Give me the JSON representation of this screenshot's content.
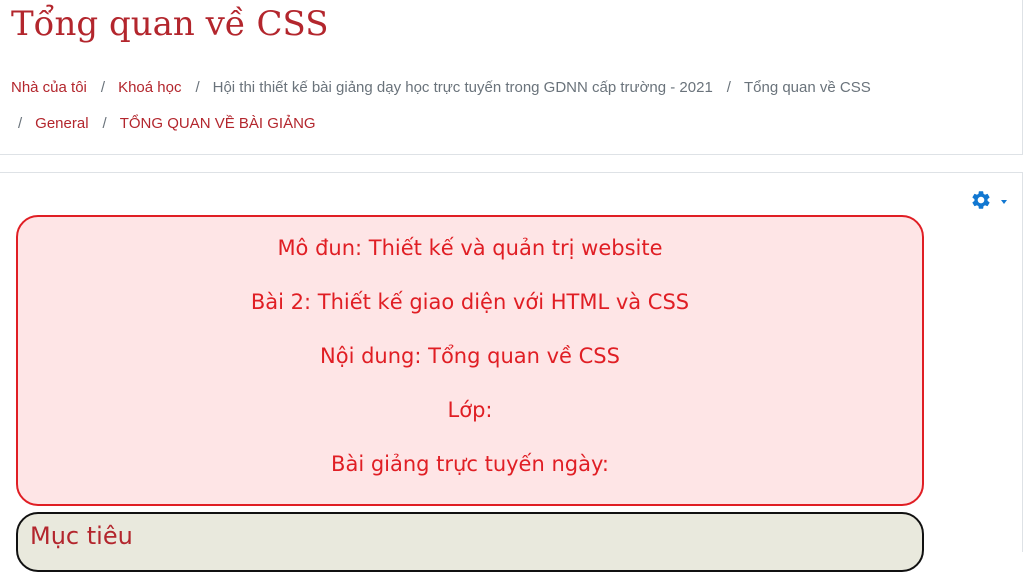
{
  "page": {
    "title": "Tổng quan về CSS"
  },
  "breadcrumb": {
    "items": [
      {
        "label": "Nhà của tôi",
        "link": true
      },
      {
        "label": "Khoá học",
        "link": true
      },
      {
        "label": "Hội thi thiết kế bài giảng dạy học trực tuyến trong GDNN cấp trường - 2021",
        "link": false
      },
      {
        "label": "Tổng quan về CSS",
        "link": false
      },
      {
        "label": "General",
        "link": true
      },
      {
        "label": "TỔNG QUAN VỀ BÀI GIẢNG",
        "link": true
      }
    ],
    "separator": "/"
  },
  "settings": {
    "icon": "gear-icon"
  },
  "info_box": {
    "lines": [
      "Mô đun: Thiết kế và quản trị website",
      "Bài 2: Thiết kế giao diện với HTML và CSS",
      "Nội dung: Tổng quan về CSS",
      "Lớp:",
      "Bài giảng trực tuyến ngày:"
    ]
  },
  "objectives_box": {
    "heading": "Mục tiêu"
  },
  "colors": {
    "brand": "#b3262d",
    "link": "#b3262d",
    "muted_text": "#6a737b",
    "accent_blue": "#1177d1",
    "info_border": "#e01e24",
    "info_background": "#fee5e6",
    "objectives_background": "#e9e9dd"
  }
}
